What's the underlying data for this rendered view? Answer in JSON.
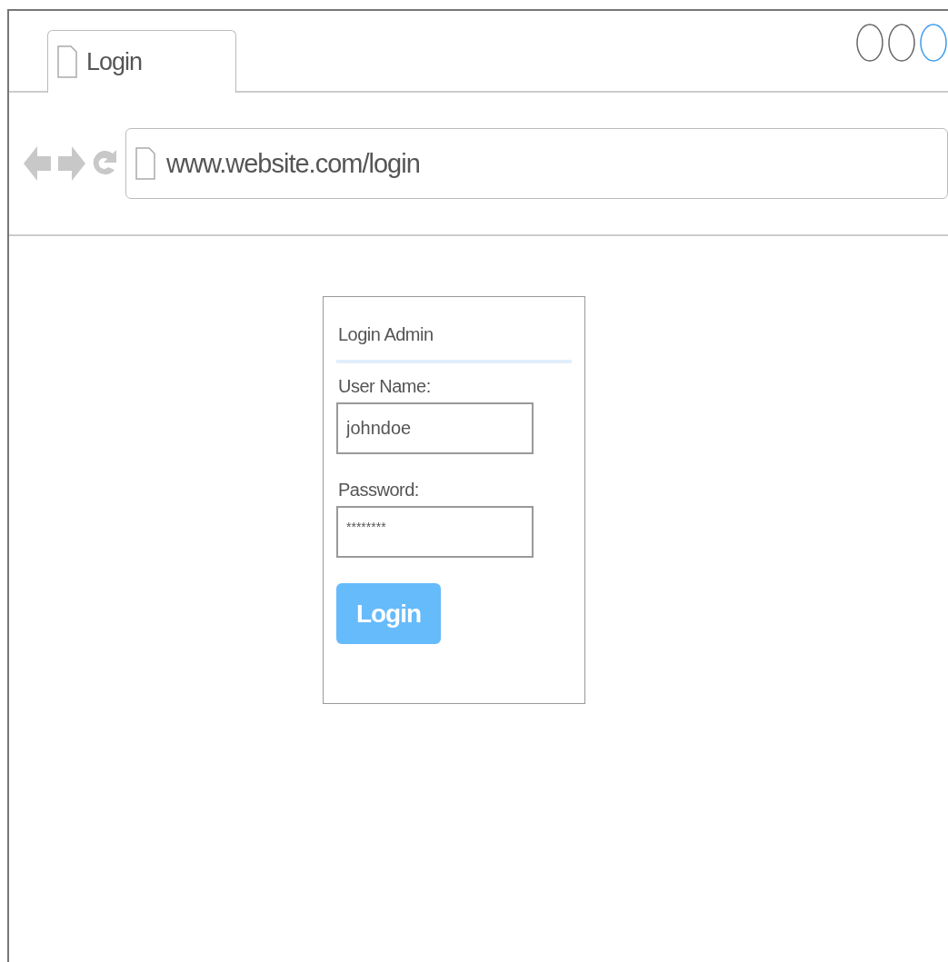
{
  "browser": {
    "tabs": [
      {
        "label": "Login",
        "selected": true
      }
    ],
    "address": "www.website.com/login"
  },
  "login_form": {
    "title": "Login Admin",
    "fields": [
      {
        "label": "User Name:",
        "value": "johndoe",
        "kind": "text"
      },
      {
        "label": "Password:",
        "value": "********",
        "kind": "password"
      }
    ],
    "button": "Login"
  }
}
